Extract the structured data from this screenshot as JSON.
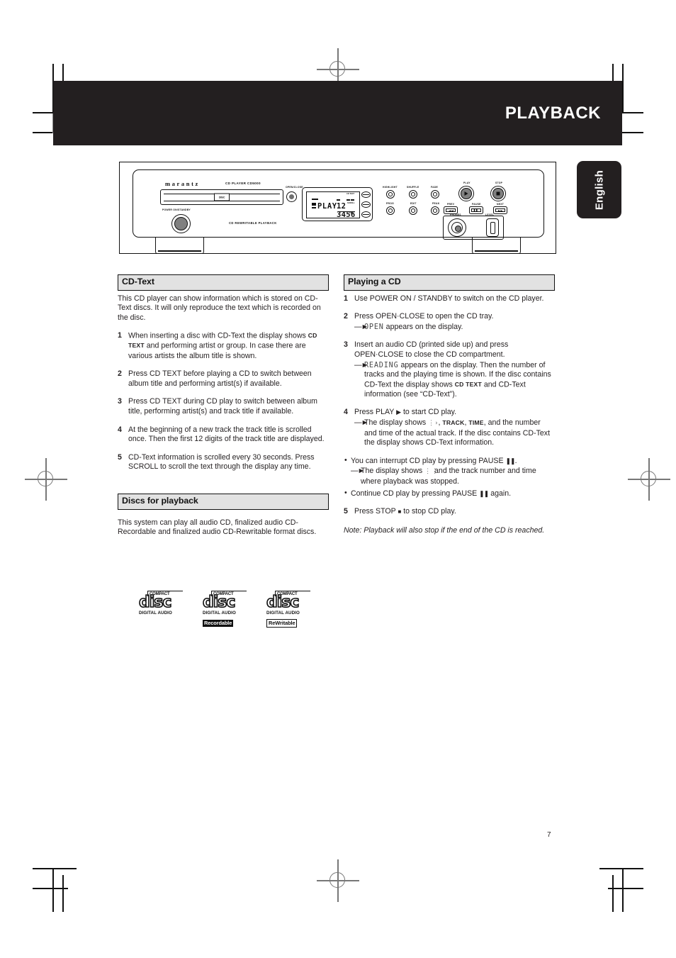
{
  "header": {
    "title": "PLAYBACK",
    "language_tab": "English"
  },
  "page": {
    "number": "7"
  },
  "device": {
    "brand": "marantz",
    "model": "CD PLAYER CD5000",
    "open_close_label": "OPEN/CLOSE",
    "power_label": "POWER ON/STANDBY",
    "footer_label": "CD REWRITABLE PLAYBACK",
    "tray_logo": "DISC",
    "display": {
      "mode": "PLAY",
      "track_digits": "12 3456",
      "indicator_cd_text": "CD TEXT",
      "indicator_scroll": "SCROLL",
      "indicator_time": "TIME",
      "indicator_random": "RANDOM",
      "indicator_track": "TRACK",
      "indicator_rew": "REW",
      "indicator_dig": "DIG"
    },
    "buttons_row1": [
      "HIGHLIGHT",
      "SHUFFLE",
      "FADE"
    ],
    "buttons_row2": [
      "PROG",
      "EDIT",
      "PEAK"
    ],
    "transport": {
      "play": "PLAY",
      "stop": "STOP",
      "prev": "PREV",
      "pause": "PAUSE",
      "next": "NEXT"
    },
    "phones_label": "PHONES",
    "level_label": "LEVEL"
  },
  "left_column": {
    "cdtext": {
      "heading": "CD-Text",
      "intro": "This CD player can show information which is stored on CD-Text discs. It will only reproduce the text which is recorded on the disc.",
      "steps": [
        {
          "num": "1",
          "text_before": "When inserting a disc with CD-Text the display shows ",
          "badge": "CD TEXT",
          "text_after": " and performing artist or group. In case there are various artists the album title is shown."
        },
        {
          "num": "2",
          "text_before": "Press CD TEXT before playing a CD to switch between album title and performing artist(s) if available.",
          "badge": "",
          "text_after": ""
        },
        {
          "num": "3",
          "text_before": "Press CD TEXT during CD play to switch between album title, performing artist(s) and track title if available.",
          "badge": "",
          "text_after": ""
        },
        {
          "num": "4",
          "text_before": "At the beginning of a new track the track title is scrolled once. Then the first 12 digits of the track title are displayed.",
          "badge": "",
          "text_after": ""
        },
        {
          "num": "5",
          "text_before": "CD-Text information is scrolled every 30 seconds. Press SCROLL to scroll the text through the display any time.",
          "badge": "",
          "text_after": ""
        }
      ]
    },
    "discs": {
      "heading": "Discs for playback",
      "text": "This system can play all audio CD, finalized audio CD-Recordable and finalized audio CD-Rewritable format discs.",
      "logos": [
        {
          "compact": "COMPACT",
          "disc": "disc",
          "digital_audio": "DIGITAL AUDIO",
          "tag": "",
          "tag_style": "none"
        },
        {
          "compact": "COMPACT",
          "disc": "disc",
          "digital_audio": "DIGITAL AUDIO",
          "tag": "Recordable",
          "tag_style": "inv"
        },
        {
          "compact": "COMPACT",
          "disc": "disc",
          "digital_audio": "DIGITAL AUDIO",
          "tag": "ReWritable",
          "tag_style": "out"
        }
      ]
    }
  },
  "right_column": {
    "heading": "Playing a CD",
    "step1": "Use POWER ON / STANDBY to switch on the CD player.",
    "step2": "Press OPEN·CLOSE to open the CD tray.",
    "step2_sub_lcd": "OPEN",
    "step2_sub_rest": " appears on the display.",
    "step3": "Insert an audio CD (printed side up) and press OPEN·CLOSE to close the CD compartment.",
    "step3_sub_lcd": "READING",
    "step3_sub_rest1": " appears on the display. Then the number of tracks and the playing time is shown. If the disc contains CD-Text the display shows ",
    "step3_badge": "CD TEXT",
    "step3_sub_rest2": " and CD-Text information (see “CD-Text”).",
    "step4_before": "Press PLAY ",
    "step4_after": " to start CD play.",
    "step4_sub_a": "The display shows ",
    "step4_sub_b": ", ",
    "step4_badge_track": "TRACK",
    "step4_sub_c": ", ",
    "step4_badge_time": "TIME",
    "step4_sub_d": ", and the number and time of the actual track. If the disc contains CD-Text the display shows CD-Text information.",
    "bullet1_before": "You can interrupt CD play by pressing PAUSE ",
    "bullet1_after": ".",
    "bullet1_sub_a": "The display shows ",
    "bullet1_sub_b": " and the track number and time where playback was stopped.",
    "bullet2_before": "Continue CD play by pressing PAUSE ",
    "bullet2_after": " again.",
    "step5_before": "Press STOP ",
    "step5_after": " to stop CD play.",
    "note": "Note: Playback will also stop if the end of the CD is reached."
  },
  "numbers": {
    "n1": "1",
    "n2": "2",
    "n3": "3",
    "n4": "4",
    "n5": "5"
  },
  "colors": {
    "ink": "#231f20",
    "heading_fill": "#e2e2e2",
    "lcd_gray": "#4a4a4a"
  }
}
